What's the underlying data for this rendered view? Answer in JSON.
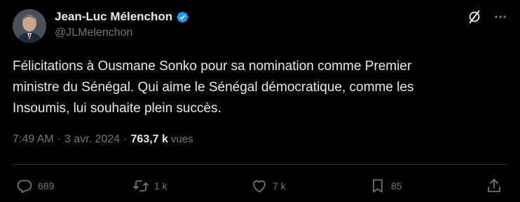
{
  "author": {
    "display_name": "Jean-Luc Mélenchon",
    "handle": "@JLMelenchon",
    "verified_badge_icon": "verified-badge-icon",
    "badge_color": "#1d9bf0"
  },
  "tweet": {
    "text": "Félicitations à Ousmane Sonko pour sa nomination comme Premier\nministre du Sénégal. Qui aime le Sénégal démocratique, comme les\nInsoumis, lui souhaite plein succès."
  },
  "meta": {
    "time": "7:49 AM",
    "separator": "·",
    "date": "3 avr. 2024",
    "views_count": "763,7 k",
    "views_label": "vues"
  },
  "actions": {
    "reply": {
      "icon": "reply-icon",
      "count": "689"
    },
    "retweet": {
      "icon": "retweet-icon",
      "count": "1 k"
    },
    "like": {
      "icon": "heart-icon",
      "count": "7 k"
    },
    "bookmark": {
      "icon": "bookmark-icon",
      "count": "85"
    },
    "share": {
      "icon": "share-icon"
    }
  },
  "header_icons": {
    "grok": "grok-icon",
    "more": "more-icon"
  },
  "colors": {
    "background": "#000000",
    "text_primary": "#e7e9ea",
    "text_secondary": "#71767b",
    "divider": "#2f3336",
    "accent": "#1d9bf0"
  }
}
